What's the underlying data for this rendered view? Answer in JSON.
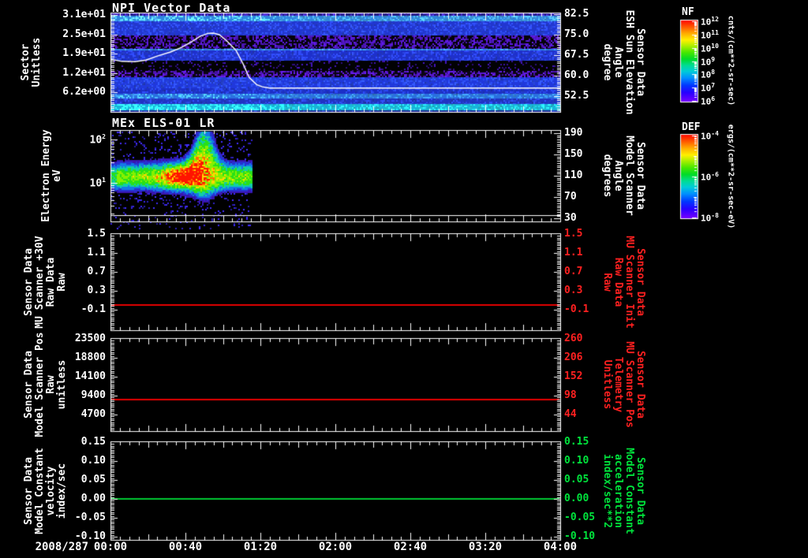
{
  "colors": {
    "background": "#000000",
    "axis_text": "#ffffff",
    "red_series": "#e60000",
    "red_label": "#ff2020",
    "green_series": "#00c832",
    "green_label": "#00e43c"
  },
  "time_axis": {
    "date_label": "2008/287",
    "tick_labels": [
      "00:00",
      "00:40",
      "01:20",
      "02:00",
      "02:40",
      "03:20",
      "04:00"
    ],
    "tick_minutes": [
      0,
      40,
      80,
      120,
      160,
      200,
      240
    ],
    "range_minutes": [
      0,
      240
    ]
  },
  "panels": [
    {
      "key": "npi",
      "kind": "spectrogram",
      "title": "NPI Vector Data",
      "left_axis": {
        "title_lines": [
          "Sector",
          "Unitless"
        ],
        "color": "#ffffff",
        "scale": "linear",
        "range": [
          32.0,
          0.0
        ],
        "ticks": [
          {
            "label": "3.1e+01",
            "value": 31.25
          },
          {
            "label": "2.5e+01",
            "value": 25.0
          },
          {
            "label": "1.9e+01",
            "value": 18.75
          },
          {
            "label": "1.2e+01",
            "value": 12.5
          },
          {
            "label": "6.2e+00",
            "value": 6.25
          }
        ]
      },
      "right_axis": {
        "title_lines": [
          "Sensor Data",
          "ESH Sun Elevation",
          "Angle",
          "degree"
        ],
        "color": "#ffffff",
        "scale": "linear",
        "range": [
          83.1,
          46.7
        ],
        "ticks": [
          {
            "label": "82.5",
            "value": 82.5
          },
          {
            "label": "75.0",
            "value": 75.0
          },
          {
            "label": "67.5",
            "value": 67.5
          },
          {
            "label": "60.0",
            "value": 60.0
          },
          {
            "label": "52.5",
            "value": 52.5
          }
        ]
      },
      "colorbar": {
        "title": "NF",
        "units": "cnts/(cm**2-sr-sec)",
        "scale": "log",
        "ticks": [
          {
            "base": "10",
            "exp": "12"
          },
          {
            "base": "10",
            "exp": "11"
          },
          {
            "base": "10",
            "exp": "10"
          },
          {
            "base": "10",
            "exp": "9"
          },
          {
            "base": "10",
            "exp": "8"
          },
          {
            "base": "10",
            "exp": "7"
          },
          {
            "base": "10",
            "exp": "6"
          }
        ]
      }
    },
    {
      "key": "els",
      "kind": "spectrogram",
      "title": "MEx ELS-01 LR",
      "left_axis": {
        "title_lines": [
          "Electron Energy",
          "eV"
        ],
        "color": "#ffffff",
        "scale": "log",
        "range": [
          166,
          1.3
        ],
        "ticks": [
          {
            "base": "10",
            "exp": "2",
            "value": 100
          },
          {
            "base": "10",
            "exp": "1",
            "value": 10
          }
        ]
      },
      "right_axis": {
        "title_lines": [
          "Sensor Data",
          "Model Scanner",
          "Angle",
          "degrees"
        ],
        "color": "#ffffff",
        "scale": "linear",
        "range": [
          196,
          24
        ],
        "ticks": [
          {
            "label": "190",
            "value": 190
          },
          {
            "label": "150",
            "value": 150
          },
          {
            "label": "110",
            "value": 110
          },
          {
            "label": "70",
            "value": 70
          },
          {
            "label": "30",
            "value": 30
          }
        ]
      },
      "colorbar": {
        "title": "DEF",
        "units": "ergs/(cm**2-sr-sec-eV)",
        "scale": "log",
        "ticks": [
          {
            "base": "10",
            "exp": "-4"
          },
          {
            "base": "10",
            "exp": "-6"
          },
          {
            "base": "10",
            "exp": "-8"
          }
        ]
      }
    },
    {
      "key": "mu_scanner_30v",
      "kind": "line",
      "title": "",
      "left_axis": {
        "title_lines": [
          "Sensor Data",
          "MU Scanner +30V",
          "Raw Data",
          "Raw"
        ],
        "color": "#ffffff",
        "scale": "linear",
        "range": [
          1.517,
          -0.533
        ],
        "ticks": [
          {
            "label": "1.5",
            "value": 1.5
          },
          {
            "label": "1.1",
            "value": 1.1
          },
          {
            "label": "0.7",
            "value": 0.7
          },
          {
            "label": "0.3",
            "value": 0.3
          },
          {
            "label": "-0.1",
            "value": -0.1
          }
        ]
      },
      "right_axis": {
        "title_lines": [
          "Sensor Data",
          "MU Scanner Init",
          "Raw Data",
          "Raw"
        ],
        "color": "#ff2020",
        "scale": "linear",
        "range": [
          1.517,
          -0.533
        ],
        "ticks": [
          {
            "label": "1.5",
            "value": 1.5
          },
          {
            "label": "1.1",
            "value": 1.1
          },
          {
            "label": "0.7",
            "value": 0.7
          },
          {
            "label": "0.3",
            "value": 0.3
          },
          {
            "label": "-0.1",
            "value": -0.1
          }
        ]
      },
      "series": {
        "color": "#e60000",
        "chart_data_index": 2
      }
    },
    {
      "key": "model_scanner_pos",
      "kind": "line",
      "title": "",
      "left_axis": {
        "title_lines": [
          "Sensor Data",
          "Model Scanner Pos",
          "Raw",
          "unitless"
        ],
        "color": "#ffffff",
        "scale": "linear",
        "range": [
          23696,
          588
        ],
        "ticks": [
          {
            "label": "23500",
            "value": 23500
          },
          {
            "label": "18800",
            "value": 18800
          },
          {
            "label": "14100",
            "value": 14100
          },
          {
            "label": "9400",
            "value": 9400
          },
          {
            "label": "4700",
            "value": 4700
          }
        ]
      },
      "right_axis": {
        "title_lines": [
          "Sensor Data",
          "MU Scanner Pos",
          "Telemetry",
          "Unitless"
        ],
        "color": "#ff2020",
        "scale": "linear",
        "range": [
          262.3,
          -3.3
        ],
        "ticks": [
          {
            "label": "260",
            "value": 260
          },
          {
            "label": "206",
            "value": 206
          },
          {
            "label": "152",
            "value": 152
          },
          {
            "label": "98",
            "value": 98
          },
          {
            "label": "44",
            "value": 44
          }
        ]
      },
      "series": {
        "color": "#e60000",
        "chart_data_index": 3
      }
    },
    {
      "key": "model_constant",
      "kind": "line",
      "title": "",
      "left_axis": {
        "title_lines": [
          "Sensor Data",
          "Model Constant",
          "velocity",
          "index/sec"
        ],
        "color": "#ffffff",
        "scale": "linear",
        "range": [
          0.1521,
          -0.1083
        ],
        "ticks": [
          {
            "label": "0.15",
            "value": 0.15
          },
          {
            "label": "0.10",
            "value": 0.1
          },
          {
            "label": "0.05",
            "value": 0.05
          },
          {
            "label": "0.00",
            "value": 0.0
          },
          {
            "label": "-0.05",
            "value": -0.05
          },
          {
            "label": "-0.10",
            "value": -0.1
          }
        ]
      },
      "right_axis": {
        "title_lines": [
          "Sensor Data",
          "Model Constant",
          "acceleration",
          "index/sec**2"
        ],
        "color": "#00e43c",
        "scale": "linear",
        "range": [
          0.1521,
          -0.1083
        ],
        "ticks": [
          {
            "label": "0.15",
            "value": 0.15
          },
          {
            "label": "0.10",
            "value": 0.1
          },
          {
            "label": "0.05",
            "value": 0.05
          },
          {
            "label": "0.00",
            "value": 0.0
          },
          {
            "label": "-0.05",
            "value": -0.05
          },
          {
            "label": "-0.10",
            "value": -0.1
          }
        ]
      },
      "series": {
        "color": "#00c832",
        "chart_data_index": 4
      }
    }
  ],
  "chart_data": [
    {
      "type": "heatmap",
      "title": "NPI Vector Data",
      "xlabel": "time 2008/287 00:00-04:00",
      "ylabel": "Sector Unitless",
      "y_range": [
        0,
        32
      ],
      "z_units": "cnts/(cm**2-sr-sec)",
      "z_range_log10": [
        6,
        12
      ],
      "bands": [
        {
          "s0": 32.0,
          "s1": 31.0,
          "base": "#201c80",
          "dot": "#5030d0",
          "p": 0.5,
          "boost": false
        },
        {
          "s0": 31.0,
          "s1": 29.2,
          "base": "#2f86e0",
          "dot": "#4ab0f4",
          "p": 0.5,
          "boost": true
        },
        {
          "s0": 29.2,
          "s1": 24.7,
          "base": "#2136d0",
          "dot": "#2c48e8",
          "p": 0.5,
          "boost": false
        },
        {
          "s0": 24.7,
          "s1": 20.4,
          "base": "#050308",
          "dot": "#4f16c0",
          "p": 0.5,
          "boost": false
        },
        {
          "s0": 20.4,
          "s1": 19.7,
          "base": "#2d7de8",
          "dot": "#3f9af0",
          "p": 0.5,
          "boost": false
        },
        {
          "s0": 19.7,
          "s1": 16.4,
          "base": "#1e30cc",
          "dot": "#2a42e0",
          "p": 0.5,
          "boost": false
        },
        {
          "s0": 16.4,
          "s1": 13.3,
          "base": "#020204",
          "dot": "#3a12a0",
          "p": 0.12,
          "boost": false
        },
        {
          "s0": 13.3,
          "s1": 11.3,
          "base": "#0a0512",
          "dot": "#5617c8",
          "p": 0.5,
          "boost": false
        },
        {
          "s0": 11.3,
          "s1": 7.7,
          "base": "#2038dc",
          "dot": "#2b4ae8",
          "p": 0.5,
          "boost": false
        },
        {
          "s0": 7.7,
          "s1": 5.8,
          "base": "#1c2fc8",
          "dot": "#2640d8",
          "p": 0.5,
          "boost": false
        },
        {
          "s0": 5.8,
          "s1": 4.3,
          "base": "#2a70e0",
          "dot": "#3a92ec",
          "p": 0.5,
          "boost": true
        },
        {
          "s0": 4.3,
          "s1": 2.5,
          "base": "#2033c4",
          "dot": "#2a44d8",
          "p": 0.5,
          "boost": false
        },
        {
          "s0": 2.5,
          "s1": 0.6,
          "base": "#18b4da",
          "dot": "#28dcec",
          "p": 0.55,
          "boost": true
        },
        {
          "s0": 0.6,
          "s1": 0.0,
          "base": "#1c2890",
          "dot": "#2636a8",
          "p": 0.4,
          "boost": false
        }
      ],
      "overlay_line": {
        "label": "ESH Sun Elevation Angle (degree, right axis)",
        "color": "#ffffff",
        "points": [
          [
            0,
            17.0
          ],
          [
            6,
            16.3
          ],
          [
            13,
            16.2
          ],
          [
            19,
            16.7
          ],
          [
            25,
            18.0
          ],
          [
            32,
            19.3
          ],
          [
            38,
            20.8
          ],
          [
            44,
            22.9
          ],
          [
            48,
            24.4
          ],
          [
            52,
            25.3
          ],
          [
            55,
            25.4
          ],
          [
            58,
            24.9
          ],
          [
            62,
            22.9
          ],
          [
            67,
            19.8
          ],
          [
            71,
            15.2
          ],
          [
            74,
            11.1
          ],
          [
            78,
            8.8
          ],
          [
            81,
            8.1
          ],
          [
            85,
            7.7
          ],
          [
            240,
            7.7
          ]
        ],
        "peak_elevation_degrees": 75.6,
        "flat_elevation_degrees": 55.4
      }
    },
    {
      "type": "heatmap",
      "title": "MEx ELS-01 LR",
      "xlabel": "time 2008/287 00:00-04:00",
      "ylabel": "Electron Energy eV",
      "y_range_eV": [
        1.3,
        166
      ],
      "z_units": "ergs/(cm**2-sr-sec-eV)",
      "z_range_log10": [
        -8,
        -4
      ],
      "coverage_minutes": [
        0,
        75
      ],
      "band_center_eV": 14,
      "enhancement": {
        "minutes": [
          25,
          60
        ],
        "peak_minutes": [
          36,
          52
        ],
        "plume_minutes": [
          46,
          58
        ],
        "plume_top_eV": 120
      }
    },
    {
      "type": "line",
      "label": "MU Scanner +30V Raw Data (red)",
      "x_range_minutes": [
        0,
        240
      ],
      "constant_value": 0.0
    },
    {
      "type": "line",
      "label": "Model Scanner Pos Raw (red)",
      "x_range_minutes": [
        0,
        240
      ],
      "constant_value": 8400
    },
    {
      "type": "line",
      "label": "Model Constant velocity (green)",
      "x_range_minutes": [
        0,
        240
      ],
      "constant_value": 0.0
    }
  ]
}
